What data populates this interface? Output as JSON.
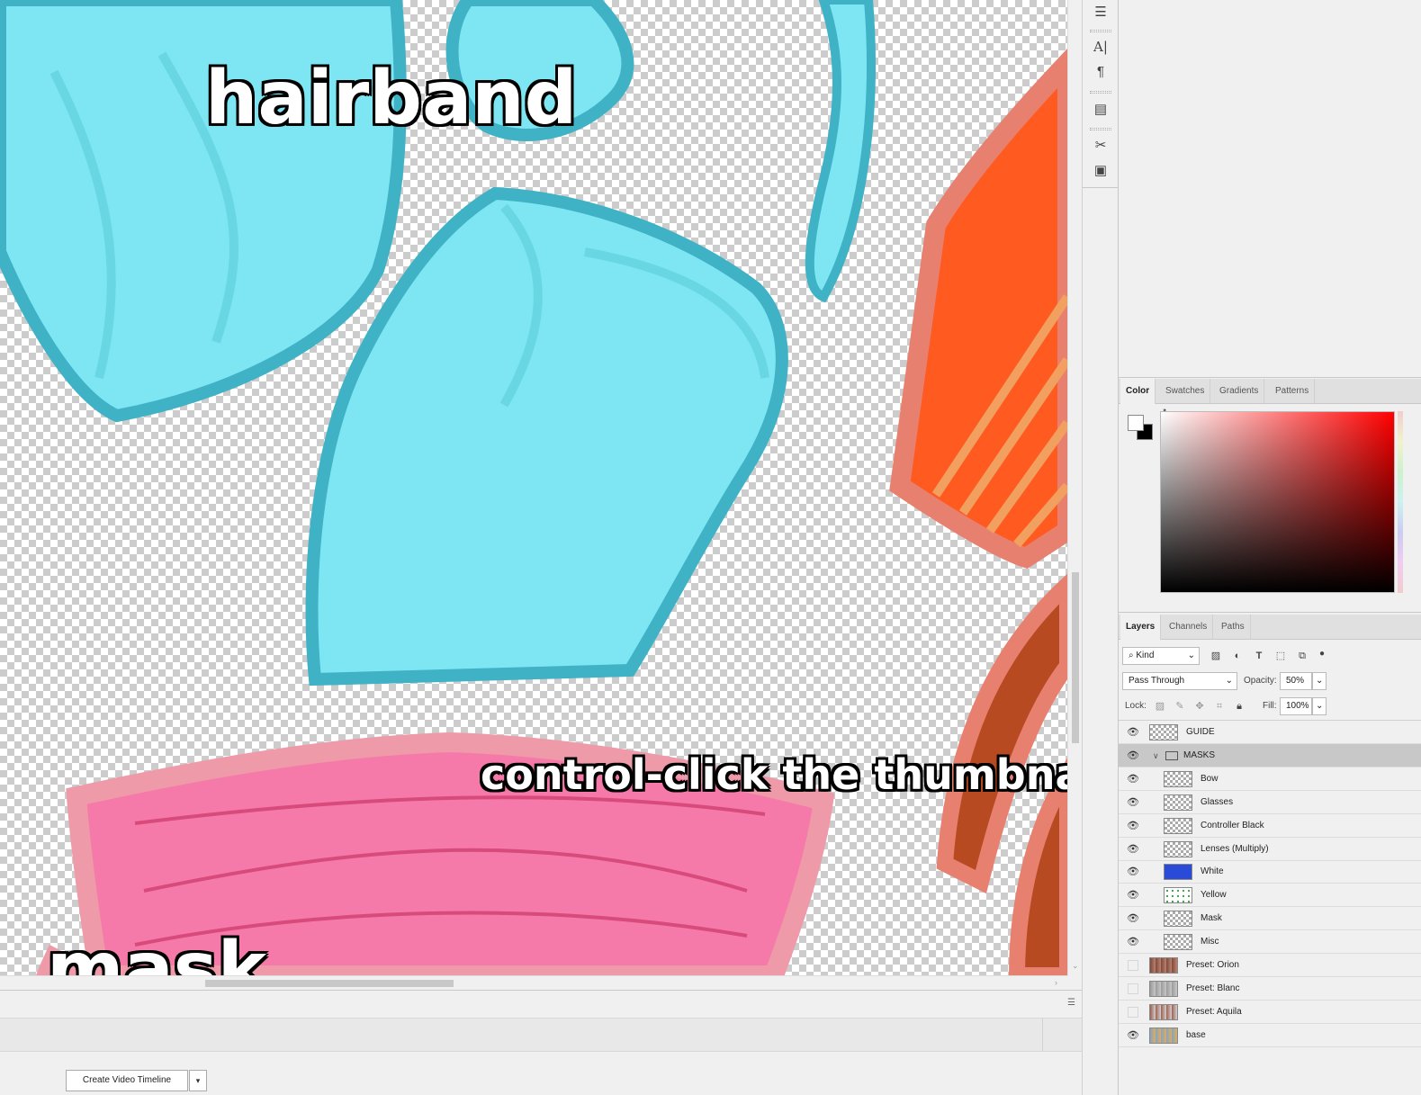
{
  "canvas": {
    "label_hairband": "hairband",
    "label_mask": "mask",
    "label_instruction": "control-click the thumbnail ->"
  },
  "timeline": {
    "create_button": "Create Video Timeline",
    "dropdown_glyph": "▾"
  },
  "tools": [
    "properties-icon",
    "character-icon",
    "paragraph-icon",
    "notes-icon",
    "tool-presets-icon",
    "clone-source-icon"
  ],
  "color_panel": {
    "tabs": [
      "Color",
      "Swatches",
      "Gradients",
      "Patterns"
    ],
    "active_tab": "Color",
    "foreground": "#ffffff",
    "background": "#000000",
    "hue": "#ff0000"
  },
  "layers_panel": {
    "tabs": [
      "Layers",
      "Channels",
      "Paths"
    ],
    "active_tab": "Layers",
    "filter_kind": "Kind",
    "blend_mode": "Pass Through",
    "opacity_label": "Opacity:",
    "opacity": "50%",
    "lock_label": "Lock:",
    "fill_label": "Fill:",
    "fill": "100%",
    "layers": [
      {
        "name": "GUIDE",
        "visible": true,
        "indent": 0,
        "group": false
      },
      {
        "name": "MASKS",
        "visible": true,
        "indent": 0,
        "group": true,
        "selected": true
      },
      {
        "name": "Bow",
        "visible": true,
        "indent": 1,
        "group": false
      },
      {
        "name": "Glasses",
        "visible": true,
        "indent": 1,
        "group": false
      },
      {
        "name": "Controller Black",
        "visible": true,
        "indent": 1,
        "group": false
      },
      {
        "name": "Lenses (Multiply)",
        "visible": true,
        "indent": 1,
        "group": false
      },
      {
        "name": "White",
        "visible": true,
        "indent": 1,
        "group": false
      },
      {
        "name": "Yellow",
        "visible": true,
        "indent": 1,
        "group": false
      },
      {
        "name": "Mask",
        "visible": true,
        "indent": 1,
        "group": false
      },
      {
        "name": "Misc",
        "visible": true,
        "indent": 1,
        "group": false
      },
      {
        "name": "Preset: Orion",
        "visible": false,
        "indent": 0,
        "group": false
      },
      {
        "name": "Preset: Blanc",
        "visible": false,
        "indent": 0,
        "group": false
      },
      {
        "name": "Preset: Aquila",
        "visible": false,
        "indent": 0,
        "group": false
      },
      {
        "name": "base",
        "visible": true,
        "indent": 0,
        "group": false
      }
    ]
  }
}
